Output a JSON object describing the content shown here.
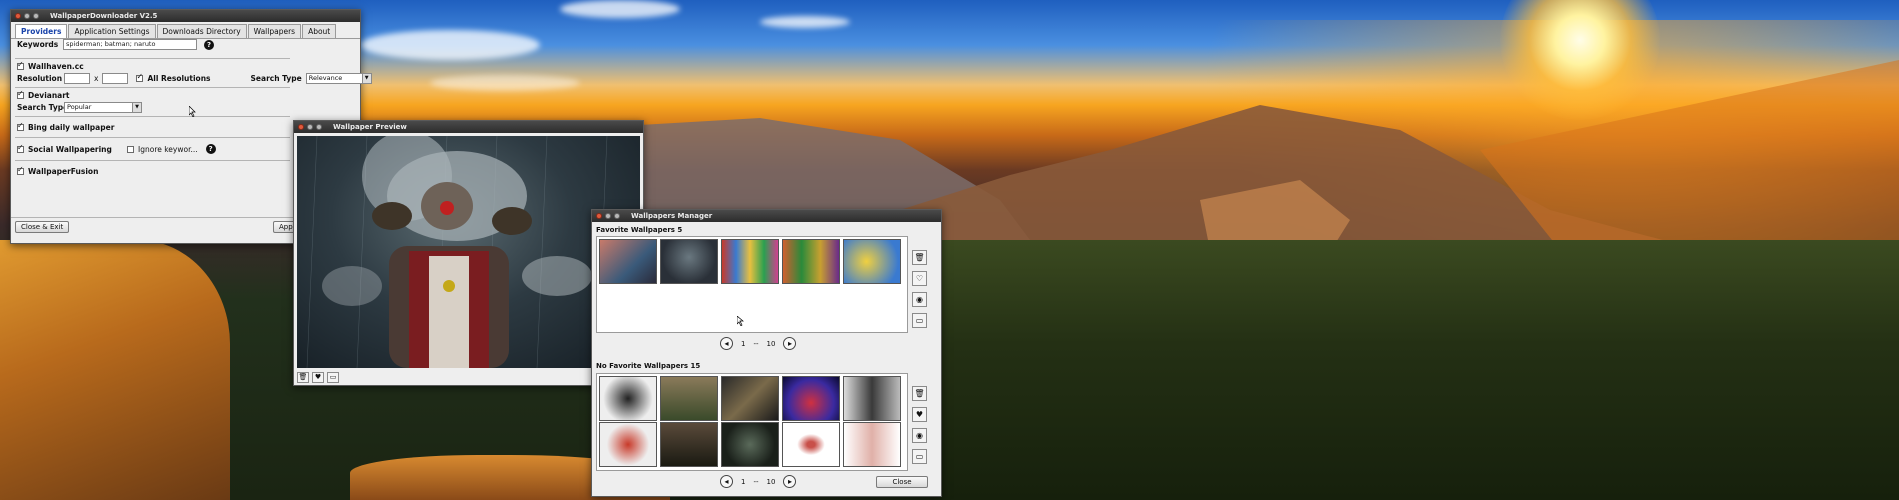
{
  "downloader": {
    "title": "WallpaperDownloader V2.5",
    "tabs": [
      {
        "label": "Providers"
      },
      {
        "label": "Application Settings"
      },
      {
        "label": "Downloads Directory"
      },
      {
        "label": "Wallpapers"
      },
      {
        "label": "About"
      }
    ],
    "keywords_label": "Keywords",
    "keywords_value": "spiderman; batman; naruto",
    "wallhaven_label": "Wallhaven.cc",
    "resolution_label": "Resolution",
    "resolution_separator": "x",
    "all_resolutions_label": "All Resolutions",
    "search_type_label": "Search Type",
    "wallhaven_search_type": "Relevance",
    "devianart_label": "Devianart",
    "devianart_search_type_label": "Search Type",
    "devianart_search_type": "Popular",
    "bing_label": "Bing daily wallpaper",
    "social_label": "Social Wallpapering",
    "ignore_keywords_label": "Ignore keywor...",
    "fusion_label": "WallpaperFusion",
    "close_exit_label": "Close & Exit",
    "apply_label": "App",
    "help_symbol": "?",
    "checked": {
      "wallhaven": true,
      "all_resolutions": true,
      "devianart": true,
      "bing": true,
      "social": true,
      "ignore_keywords": false,
      "fusion": true
    }
  },
  "preview": {
    "title": "Wallpaper Preview"
  },
  "manager": {
    "title": "Wallpapers Manager",
    "favorite_label": "Favorite Wallpapers  5",
    "nofavorite_label": "No Favorite Wallpapers  15",
    "pager_top": {
      "current": "1",
      "separator": "--",
      "total": "10"
    },
    "pager_bottom": {
      "current": "1",
      "separator": "--",
      "total": "10"
    },
    "close_label": "Close"
  },
  "icons": {
    "trash": "trash-icon",
    "heart": "heart-icon",
    "eye": "eye-icon",
    "monitor": "monitor-icon",
    "left_arrow": "arrow-left-icon",
    "right_arrow": "arrow-right-icon"
  },
  "colors": {
    "active_tab": "#1a44aa",
    "titlebar": "#2c2c2c",
    "close_button": "#e05a3c"
  }
}
